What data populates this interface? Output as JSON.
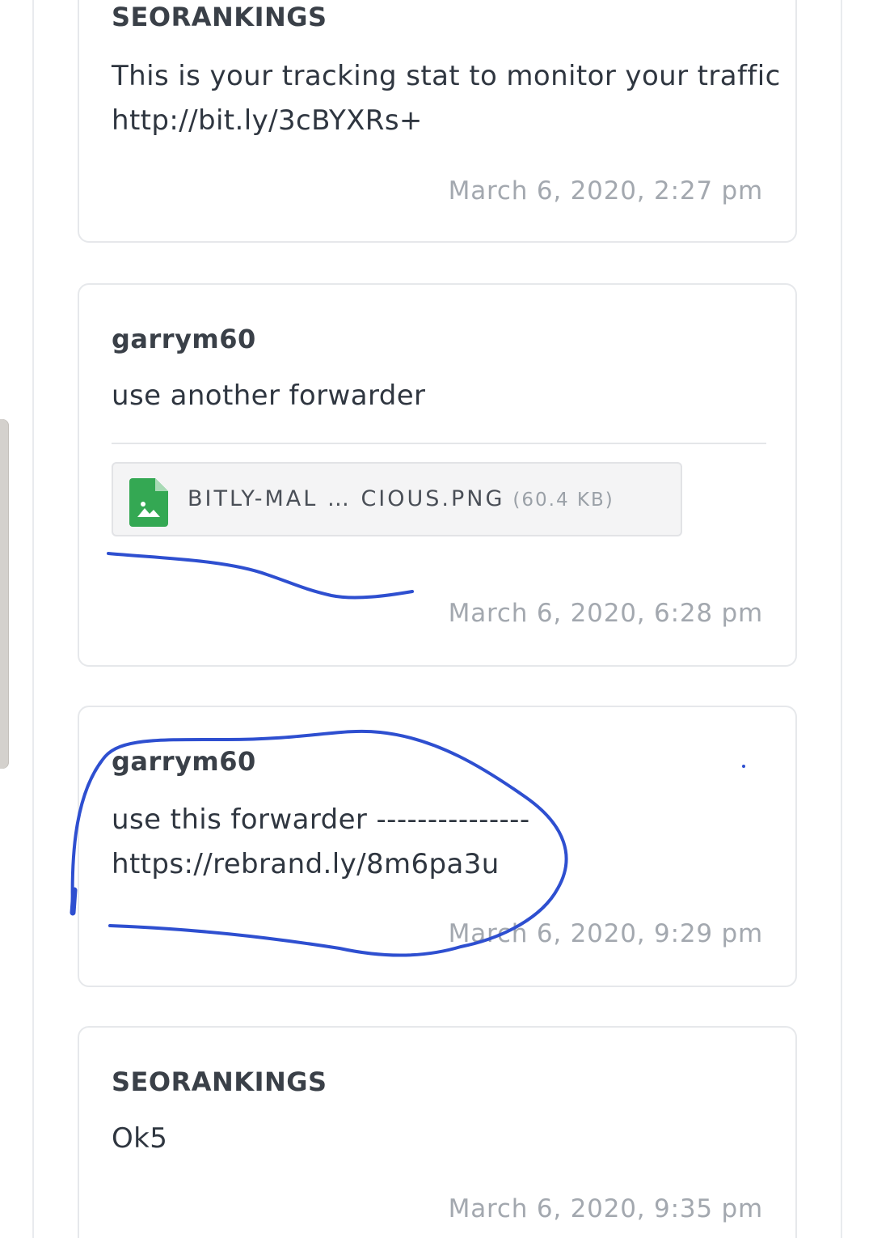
{
  "colors": {
    "card_border": "#e6e8eb",
    "timestamp": "#a3a8af",
    "file_icon": "#34a853",
    "annotation_ink": "#2e4fd0"
  },
  "messages": [
    {
      "author": "SEORANKINGS",
      "lines": [
        "This is your tracking stat to monitor your traffic",
        "http://bit.ly/3cBYXRs+"
      ],
      "timestamp": "March 6, 2020, 2:27 pm"
    },
    {
      "author": "garrym60",
      "lines": [
        "use another forwarder"
      ],
      "attachment": {
        "icon": "image-file-icon",
        "name": "BITLY-MAL … CIOUS.PNG",
        "size": "(60.4 KB)"
      },
      "timestamp": "March 6, 2020, 6:28 pm"
    },
    {
      "author": "garrym60",
      "lines": [
        "use this forwarder ---------------",
        "https://rebrand.ly/8m6pa3u"
      ],
      "timestamp": "March 6, 2020, 9:29 pm"
    },
    {
      "author": "SEORANKINGS",
      "lines": [
        "Ok5"
      ],
      "timestamp": "March 6, 2020, 9:35 pm"
    }
  ]
}
